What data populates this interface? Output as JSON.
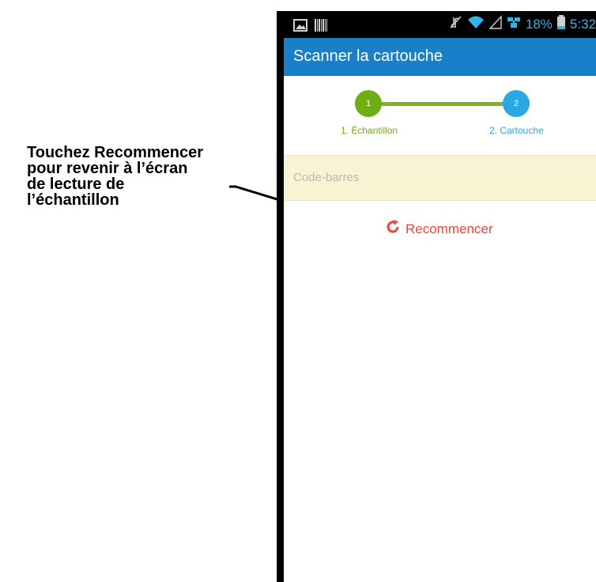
{
  "callout": {
    "lines": [
      "Touchez Recommencer",
      "pour revenir à l’écran",
      "de lecture de",
      "l’échantillon"
    ]
  },
  "status_bar": {
    "icons": [
      "image-icon",
      "barcode-icon",
      "mute-icon",
      "wifi-icon",
      "signal-icon",
      "network-icon",
      "battery-icon"
    ],
    "battery_percent": "18%",
    "time": "5:32"
  },
  "app_bar": {
    "title": "Scanner la cartouche",
    "color": "#1a7fc9"
  },
  "stepper": {
    "steps": [
      {
        "number": "1",
        "label": "1. Échantillon",
        "color": "#6fad15"
      },
      {
        "number": "2",
        "label": "2. Cartouche",
        "color": "#2aa7e5"
      }
    ]
  },
  "barcode": {
    "label": "Code-barres"
  },
  "restart": {
    "label": "Recommencer",
    "icon": "refresh-icon",
    "color": "#e8463d"
  }
}
